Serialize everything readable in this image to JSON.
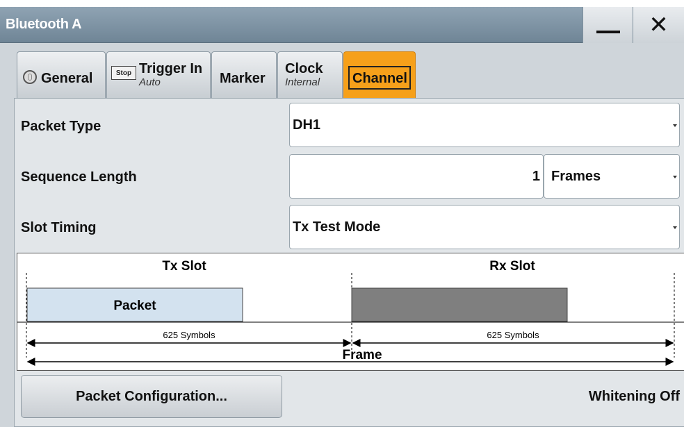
{
  "window": {
    "title": "Bluetooth A",
    "minimize_icon": "minimize-icon",
    "close_icon": "close-icon"
  },
  "tabs": [
    {
      "label": "General",
      "sub": "",
      "icon": "general-icon"
    },
    {
      "label": "Trigger In",
      "sub": "Auto",
      "icon": "stop-icon",
      "icon_text": "Stop"
    },
    {
      "label": "Marker",
      "sub": ""
    },
    {
      "label": "Clock",
      "sub": "Internal"
    },
    {
      "label": "Channel",
      "sub": "",
      "active": true
    }
  ],
  "settings": {
    "packet_type": {
      "label": "Packet Type",
      "value": "DH1"
    },
    "sequence_length": {
      "label": "Sequence Length",
      "value": "1",
      "unit": "Frames"
    },
    "slot_timing": {
      "label": "Slot Timing",
      "value": "Tx Test Mode"
    }
  },
  "diagram": {
    "tx_slot_label": "Tx Slot",
    "rx_slot_label": "Rx Slot",
    "packet_label": "Packet",
    "tx_symbols": "625 Symbols",
    "rx_symbols": "625 Symbols",
    "frame_label": "Frame"
  },
  "footer": {
    "packet_config_button": "Packet Configuration...",
    "whitening_status": "Whitening Off"
  },
  "colors": {
    "active_tab": "#f6a01a",
    "tx_packet": "#d3e2ef",
    "rx_packet": "#7f7f7f",
    "titlebar": "#7d92a3"
  }
}
